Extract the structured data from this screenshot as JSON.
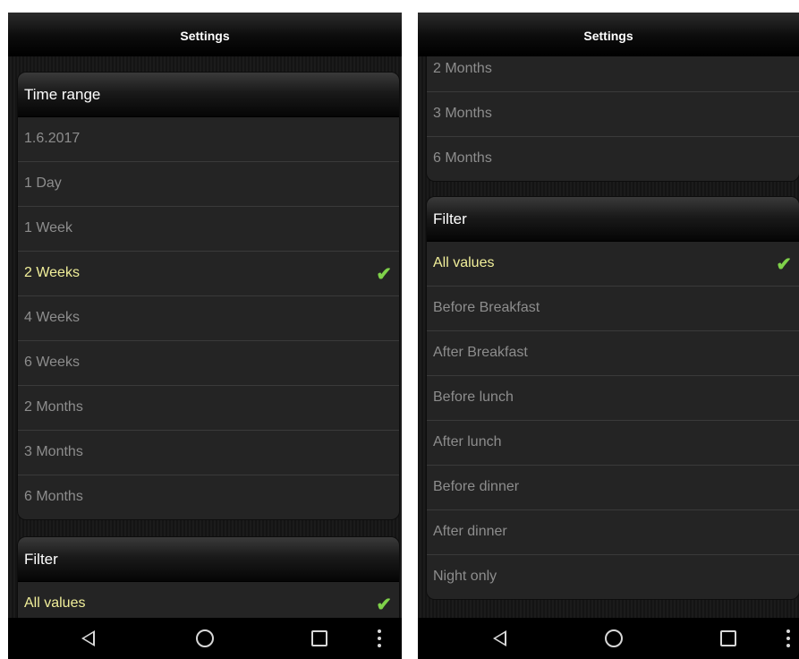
{
  "left": {
    "title": "Settings",
    "time_range": {
      "header": "Time range",
      "items": [
        "1.6.2017",
        "1 Day",
        "1 Week",
        "2 Weeks",
        "4 Weeks",
        "6 Weeks",
        "2 Months",
        "3 Months",
        "6 Months"
      ],
      "selected": "2 Weeks"
    },
    "filter": {
      "header": "Filter",
      "items": [
        "All values"
      ],
      "selected": "All values"
    }
  },
  "right": {
    "title": "Settings",
    "time_range": {
      "items": [
        "2 Months",
        "3 Months",
        "6 Months"
      ]
    },
    "filter": {
      "header": "Filter",
      "items": [
        "All values",
        "Before Breakfast",
        "After Breakfast",
        "Before lunch",
        "After lunch",
        "Before dinner",
        "After dinner",
        "Night only"
      ],
      "selected": "All values"
    }
  },
  "icons": {
    "check": "checkmark-icon",
    "back": "back-triangle-icon",
    "home": "home-circle-icon",
    "recent": "recent-apps-square-icon",
    "menu": "overflow-menu-icon"
  },
  "colors": {
    "selected_text": "#f1ef9a",
    "check": "#7fd14a",
    "item_text": "#8d8d8d"
  }
}
